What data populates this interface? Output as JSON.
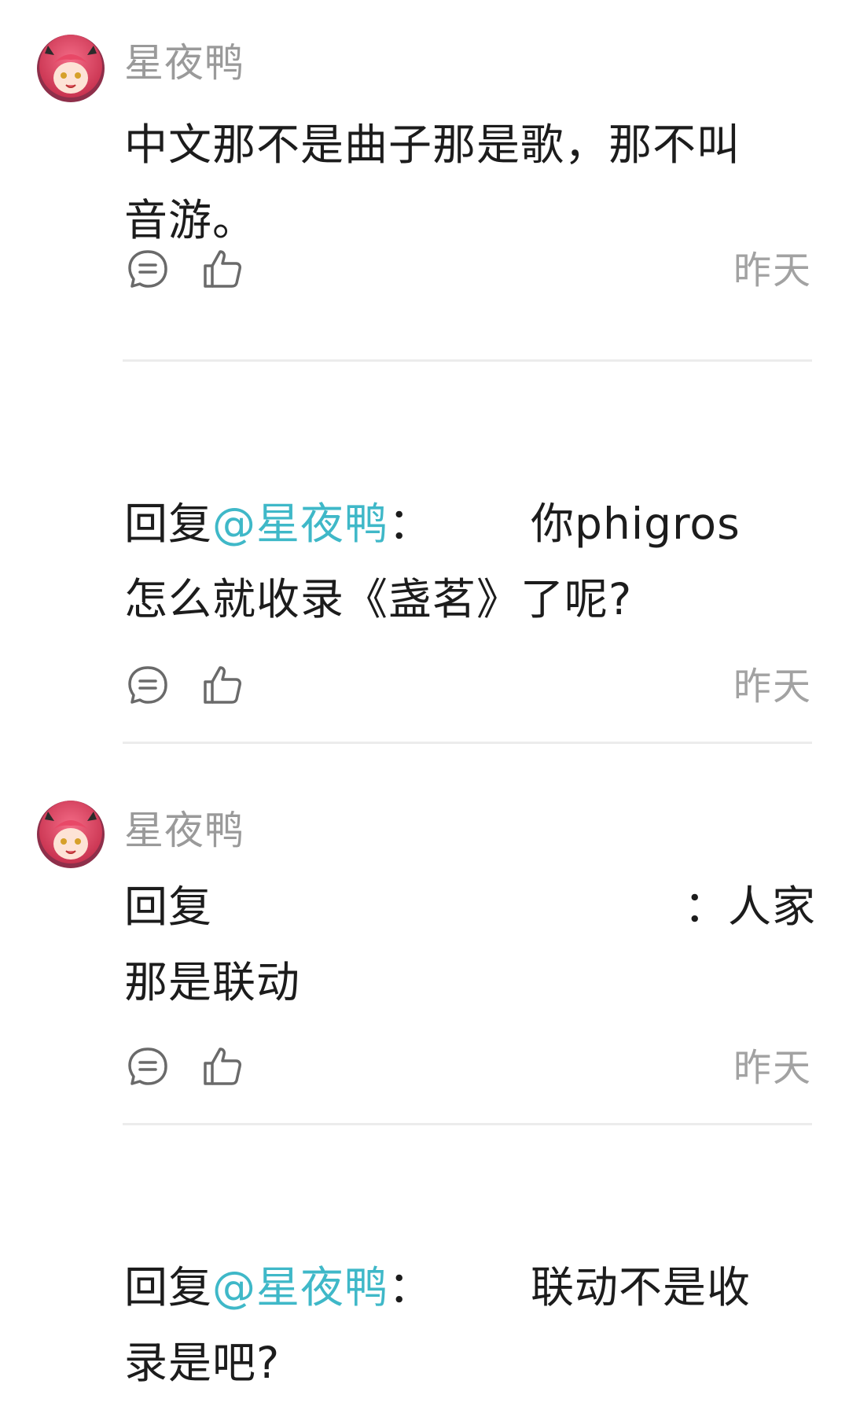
{
  "comments": [
    {
      "username": "星夜鸭",
      "lines": [
        "中文那不是曲子那是歌，那不叫",
        "音游。"
      ],
      "time": "昨天"
    },
    {
      "reply_prefix": "回复",
      "mention": "@星夜鸭",
      "colon": "：",
      "line1_tail": "你phigros",
      "line2": "怎么就收录《盏茗》了呢?",
      "time": "昨天"
    },
    {
      "username": "星夜鸭",
      "reply_prefix": "回复",
      "line1_tail": "：人家",
      "line2": "那是联动",
      "time": "昨天"
    },
    {
      "reply_prefix": "回复",
      "mention": "@星夜鸭",
      "colon": "：",
      "line1_tail": "联动不是收",
      "line2": "录是吧?"
    }
  ],
  "icons": {
    "reply": "comment-bubble-icon",
    "like": "thumbs-up-icon"
  },
  "colors": {
    "mention": "#3fb8c8",
    "username": "#9a9a9a",
    "time": "#a2a2a2",
    "divider": "#ececec"
  }
}
